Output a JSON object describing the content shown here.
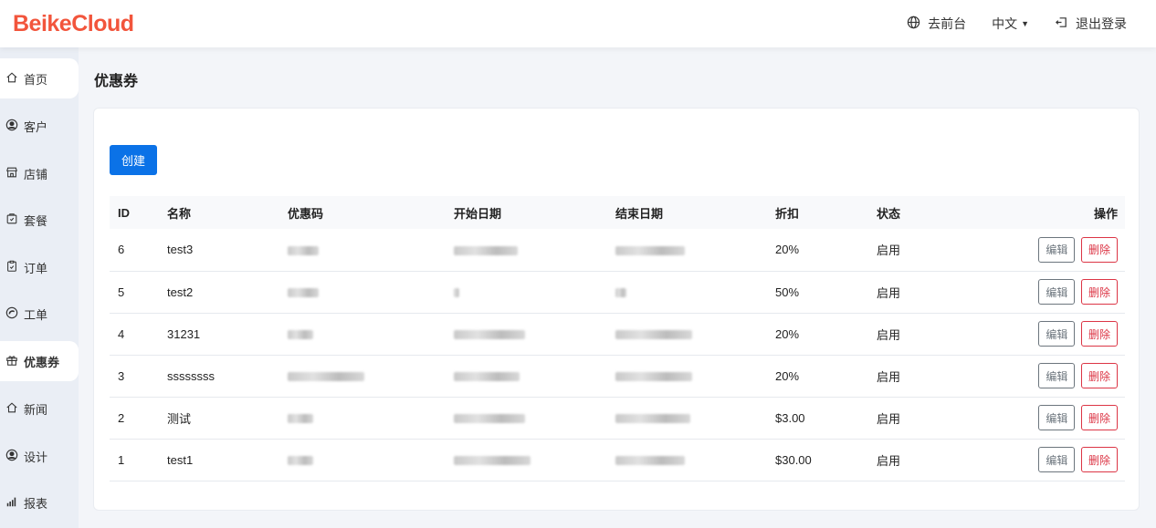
{
  "header": {
    "logo": "BeikeCloud",
    "nav": [
      {
        "label": "去前台",
        "icon": "globe-icon"
      },
      {
        "label": "中文",
        "icon": "caret-down-icon"
      },
      {
        "label": "退出登录",
        "icon": "logout-icon"
      }
    ]
  },
  "sidebar": {
    "items": [
      {
        "label": "首页",
        "icon": "home-icon"
      },
      {
        "label": "客户",
        "icon": "user-circle-icon"
      },
      {
        "label": "店铺",
        "icon": "shop-icon"
      },
      {
        "label": "套餐",
        "icon": "package-icon"
      },
      {
        "label": "订单",
        "icon": "clipboard-icon"
      },
      {
        "label": "工单",
        "icon": "ticket-icon"
      },
      {
        "label": "优惠券",
        "icon": "gift-icon"
      },
      {
        "label": "新闻",
        "icon": "news-icon"
      },
      {
        "label": "设计",
        "icon": "design-icon"
      },
      {
        "label": "报表",
        "icon": "chart-icon"
      }
    ],
    "active": "优惠券"
  },
  "page": {
    "title": "优惠券",
    "create_label": "创建"
  },
  "table": {
    "headers": [
      "ID",
      "名称",
      "优惠码",
      "开始日期",
      "结束日期",
      "折扣",
      "状态",
      "操作"
    ],
    "edit_label": "编辑",
    "delete_label": "删除",
    "rows": [
      {
        "id": "6",
        "name": "test3",
        "discount": "20%",
        "status": "启用"
      },
      {
        "id": "5",
        "name": "test2",
        "discount": "50%",
        "status": "启用"
      },
      {
        "id": "4",
        "name": "31231",
        "discount": "20%",
        "status": "启用"
      },
      {
        "id": "3",
        "name": "ssssssss",
        "discount": "20%",
        "status": "启用"
      },
      {
        "id": "2",
        "name": "测试",
        "discount": "$3.00",
        "status": "启用"
      },
      {
        "id": "1",
        "name": "test1",
        "discount": "$30.00",
        "status": "启用"
      }
    ]
  }
}
